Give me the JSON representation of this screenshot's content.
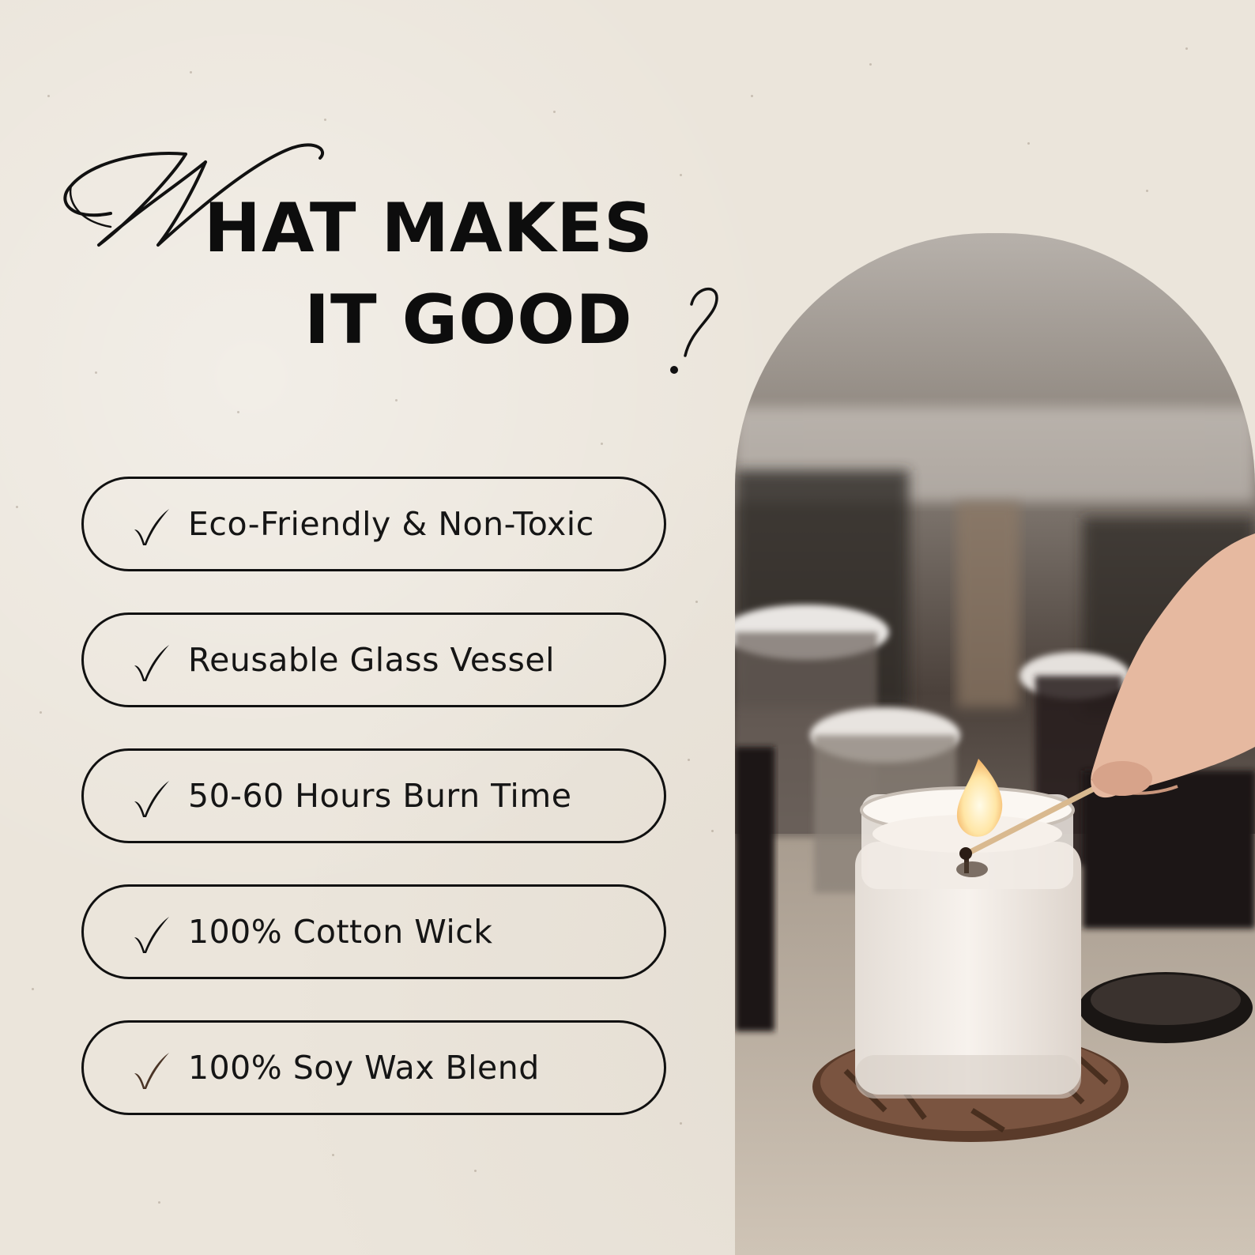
{
  "title": {
    "script_letter": "W",
    "line1_rest": "HAT MAKES",
    "line2": "IT GOOD",
    "question_mark": "?"
  },
  "features": [
    {
      "icon": "check-icon",
      "label": "Eco-Friendly & Non-Toxic",
      "check_color": "#111111"
    },
    {
      "icon": "check-icon",
      "label": "Reusable Glass Vessel",
      "check_color": "#111111"
    },
    {
      "icon": "check-icon",
      "label": "50-60 Hours Burn Time",
      "check_color": "#111111"
    },
    {
      "icon": "check-icon",
      "label": "100% Cotton Wick",
      "check_color": "#111111"
    },
    {
      "icon": "check-icon",
      "label": "100% Soy Wax Blend",
      "check_color": "#4a3426"
    }
  ],
  "colors": {
    "background": "#ebe5db",
    "text": "#111111",
    "accent_brown": "#4a3426"
  },
  "photo": {
    "icon": "candle-photo"
  }
}
